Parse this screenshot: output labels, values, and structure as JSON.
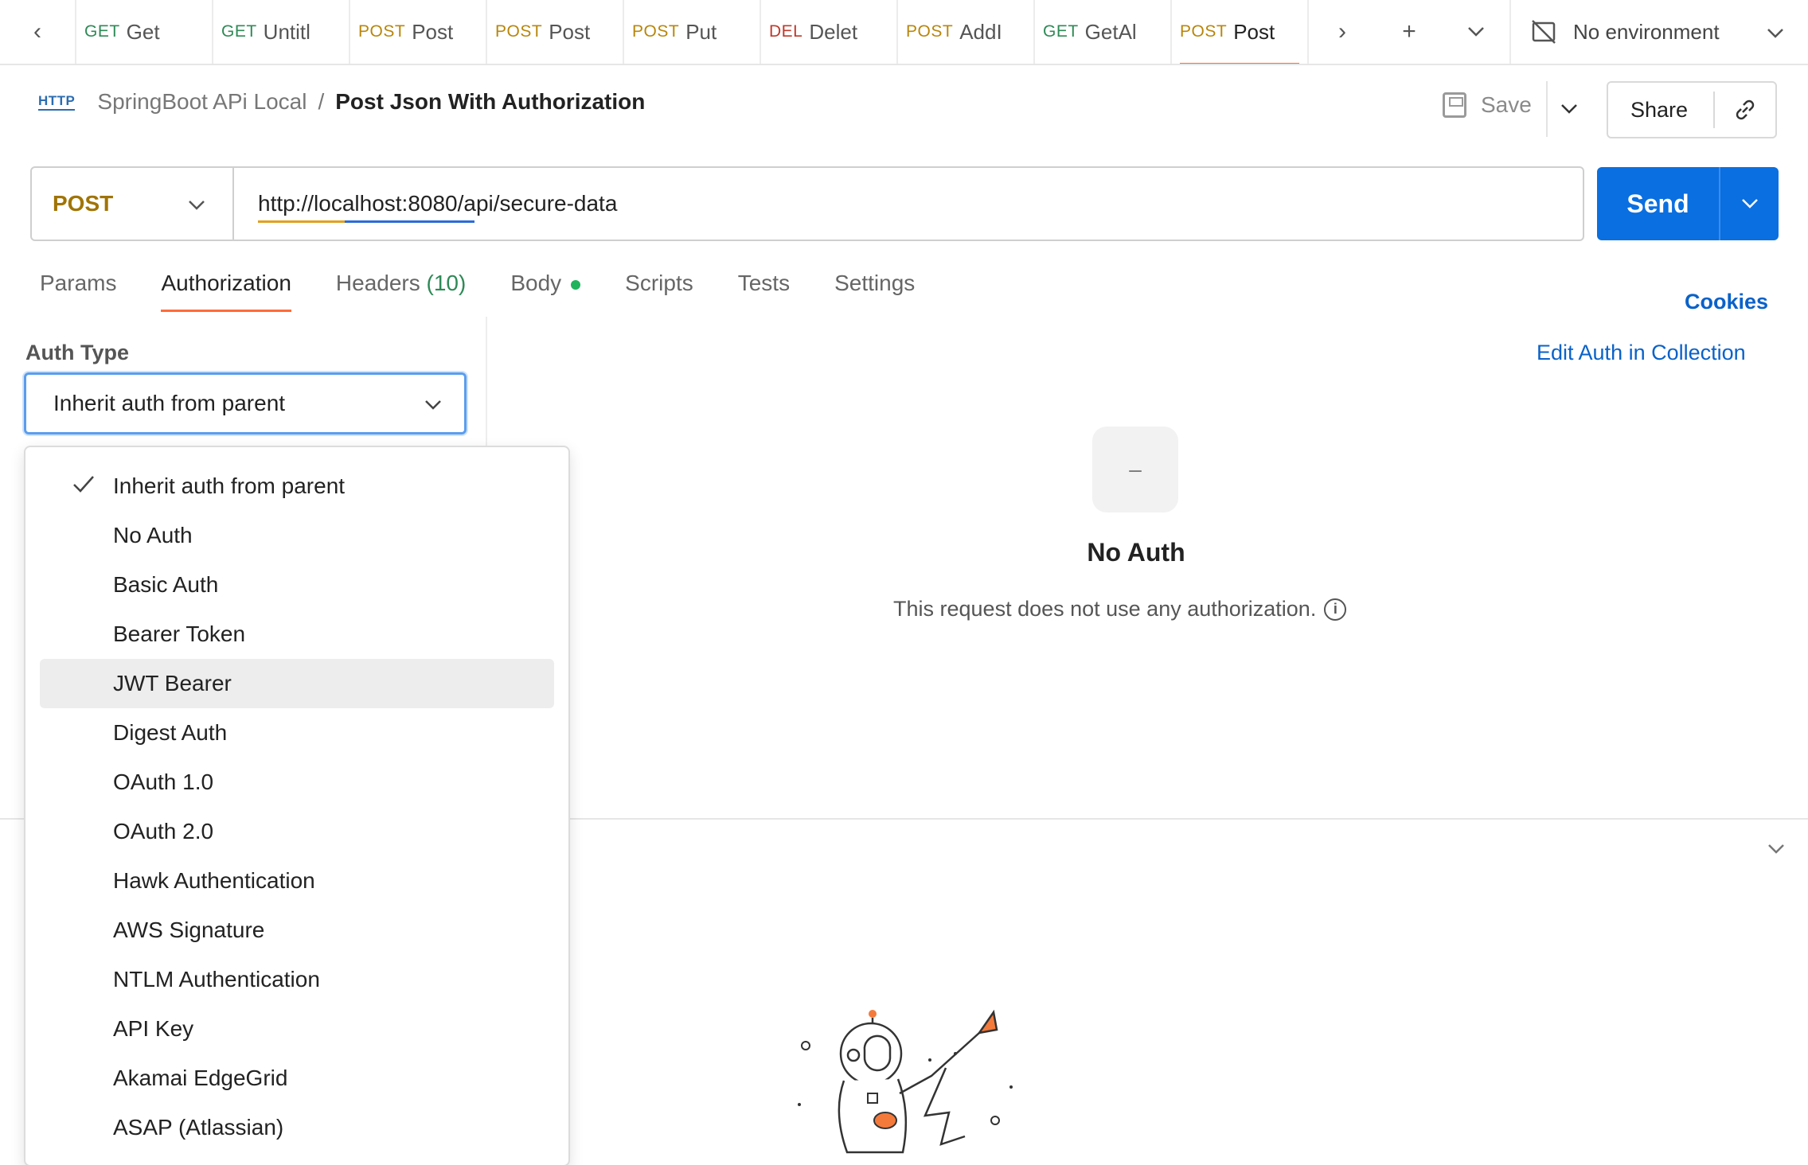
{
  "tabbar": {
    "tabs": [
      {
        "method": "GET",
        "name": "Get",
        "method_class": "m-get"
      },
      {
        "method": "GET",
        "name": "Untitl",
        "method_class": "m-get"
      },
      {
        "method": "POST",
        "name": "Post",
        "method_class": "m-post"
      },
      {
        "method": "POST",
        "name": "Post",
        "method_class": "m-post"
      },
      {
        "method": "POST",
        "name": "Put",
        "method_class": "m-post"
      },
      {
        "method": "DEL",
        "name": "Delet",
        "method_class": "m-del"
      },
      {
        "method": "POST",
        "name": "AddI",
        "method_class": "m-post"
      },
      {
        "method": "GET",
        "name": "GetAl",
        "method_class": "m-get"
      },
      {
        "method": "POST",
        "name": "Post",
        "method_class": "m-post",
        "active": true
      }
    ],
    "environment": "No environment"
  },
  "breadcrumb": {
    "badge": "HTTP",
    "collection": "SpringBoot APi Local",
    "separator": "/",
    "request": "Post Json With Authorization"
  },
  "actions": {
    "save_label": "Save",
    "share_label": "Share"
  },
  "request": {
    "method": "POST",
    "url": "http://localhost:8080/api/secure-data",
    "send_label": "Send"
  },
  "req_tabs": {
    "params": "Params",
    "authorization": "Authorization",
    "headers": "Headers",
    "headers_count": "(10)",
    "body": "Body",
    "scripts": "Scripts",
    "tests": "Tests",
    "settings": "Settings",
    "cookies": "Cookies"
  },
  "auth": {
    "type_label": "Auth Type",
    "selected": "Inherit auth from parent",
    "edit_link": "Edit Auth in Collection",
    "options": [
      "Inherit auth from parent",
      "No Auth",
      "Basic Auth",
      "Bearer Token",
      "JWT Bearer",
      "Digest Auth",
      "OAuth 1.0",
      "OAuth 2.0",
      "Hawk Authentication",
      "AWS Signature",
      "NTLM Authentication",
      "API Key",
      "Akamai EdgeGrid",
      "ASAP (Atlassian)"
    ],
    "checked_index": 0,
    "hover_index": 4
  },
  "no_auth": {
    "icon_glyph": "–",
    "title": "No Auth",
    "description": "This request does not use any authorization."
  },
  "colors": {
    "accent": "#ff6c37",
    "send": "#0a6fe0",
    "link": "#0a62c9",
    "post": "#b8860b",
    "get": "#2e8a56",
    "del": "#c0392b"
  }
}
